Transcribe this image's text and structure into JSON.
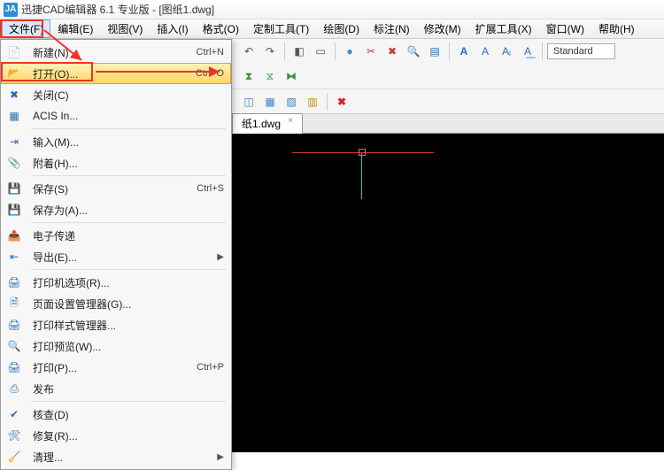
{
  "window": {
    "title": "迅捷CAD编辑器 6.1 专业版  -  [图纸1.dwg]"
  },
  "menu": {
    "file": "文件(F)",
    "edit": "编辑(E)",
    "view": "视图(V)",
    "insert": "插入(I)",
    "format": "格式(O)",
    "custom": "定制工具(T)",
    "draw": "绘图(D)",
    "annotate": "标注(N)",
    "modify": "修改(M)",
    "ext": "扩展工具(X)",
    "window": "窗口(W)",
    "help": "帮助(H)"
  },
  "filemenu": {
    "new": "新建(N)",
    "new_sc": "Ctrl+N",
    "open": "打开(O)...",
    "open_sc": "Ctrl+O",
    "close": "关闭(C)",
    "acis": "ACIS In...",
    "import": "输入(M)...",
    "attach": "附着(H)...",
    "save": "保存(S)",
    "save_sc": "Ctrl+S",
    "saveas": "保存为(A)...",
    "etrans": "电子传递",
    "export": "导出(E)...",
    "printer": "打印机选项(R)...",
    "pagesetup": "页面设置管理器(G)...",
    "printstyle": "打印样式管理器...",
    "preview": "打印预览(W)...",
    "print": "打印(P)...",
    "print_sc": "Ctrl+P",
    "publish": "发布",
    "audit": "核查(D)",
    "recover": "修复(R)...",
    "purge": "清理..."
  },
  "tab": {
    "label": "纸1.dwg"
  },
  "style": {
    "value": "Standard"
  }
}
